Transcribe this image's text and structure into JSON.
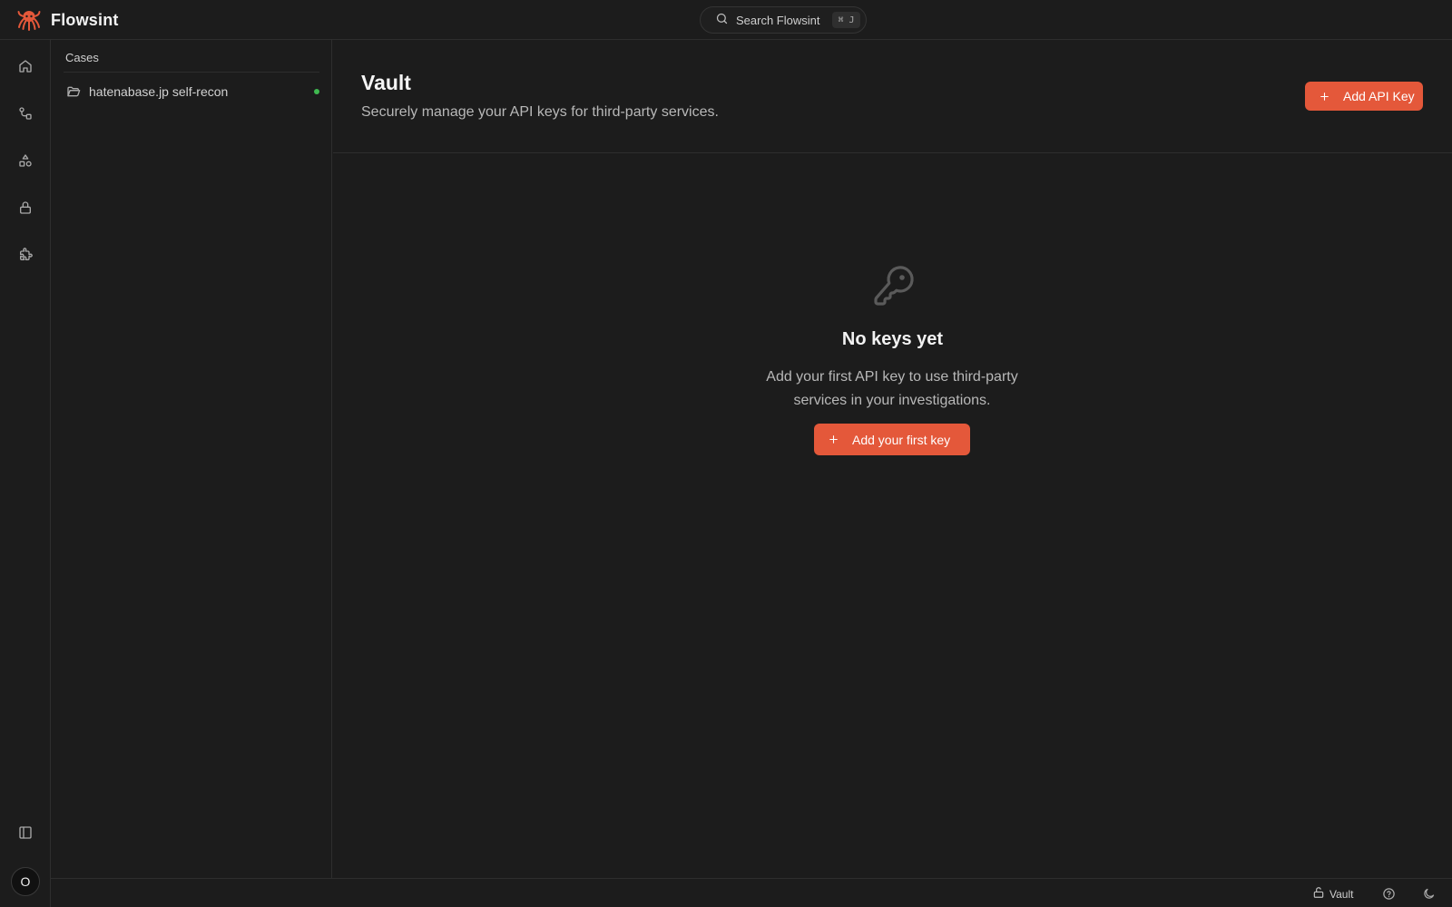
{
  "app": {
    "name": "Flowsint"
  },
  "search": {
    "label": "Search Flowsint",
    "shortcut": "⌘ J"
  },
  "rail": {
    "items": [
      {
        "name": "home-icon"
      },
      {
        "name": "flows-icon"
      },
      {
        "name": "shapes-icon"
      },
      {
        "name": "lock-icon"
      },
      {
        "name": "puzzle-icon"
      }
    ],
    "avatar_initial": "O"
  },
  "cases": {
    "title": "Cases",
    "items": [
      {
        "label": "hatenabase.jp self-recon",
        "status": "active"
      }
    ]
  },
  "vault": {
    "title": "Vault",
    "subtitle": "Securely manage your API keys for third-party services.",
    "add_button": "Add API Key",
    "empty": {
      "title": "No keys yet",
      "text": "Add your first API key to use third-party services in your investigations.",
      "button": "Add your first key"
    }
  },
  "statusbar": {
    "vault_label": "Vault"
  },
  "colors": {
    "accent": "#e4583a",
    "background": "#1c1c1c",
    "active_dot": "#3fb950"
  }
}
